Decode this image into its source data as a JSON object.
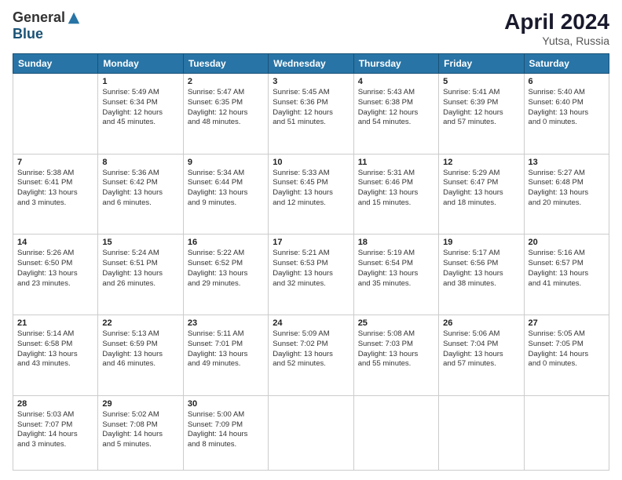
{
  "header": {
    "logo_general": "General",
    "logo_blue": "Blue",
    "month_year": "April 2024",
    "location": "Yutsa, Russia"
  },
  "weekdays": [
    "Sunday",
    "Monday",
    "Tuesday",
    "Wednesday",
    "Thursday",
    "Friday",
    "Saturday"
  ],
  "weeks": [
    [
      {
        "day": "",
        "info": ""
      },
      {
        "day": "1",
        "info": "Sunrise: 5:49 AM\nSunset: 6:34 PM\nDaylight: 12 hours\nand 45 minutes."
      },
      {
        "day": "2",
        "info": "Sunrise: 5:47 AM\nSunset: 6:35 PM\nDaylight: 12 hours\nand 48 minutes."
      },
      {
        "day": "3",
        "info": "Sunrise: 5:45 AM\nSunset: 6:36 PM\nDaylight: 12 hours\nand 51 minutes."
      },
      {
        "day": "4",
        "info": "Sunrise: 5:43 AM\nSunset: 6:38 PM\nDaylight: 12 hours\nand 54 minutes."
      },
      {
        "day": "5",
        "info": "Sunrise: 5:41 AM\nSunset: 6:39 PM\nDaylight: 12 hours\nand 57 minutes."
      },
      {
        "day": "6",
        "info": "Sunrise: 5:40 AM\nSunset: 6:40 PM\nDaylight: 13 hours\nand 0 minutes."
      }
    ],
    [
      {
        "day": "7",
        "info": "Sunrise: 5:38 AM\nSunset: 6:41 PM\nDaylight: 13 hours\nand 3 minutes."
      },
      {
        "day": "8",
        "info": "Sunrise: 5:36 AM\nSunset: 6:42 PM\nDaylight: 13 hours\nand 6 minutes."
      },
      {
        "day": "9",
        "info": "Sunrise: 5:34 AM\nSunset: 6:44 PM\nDaylight: 13 hours\nand 9 minutes."
      },
      {
        "day": "10",
        "info": "Sunrise: 5:33 AM\nSunset: 6:45 PM\nDaylight: 13 hours\nand 12 minutes."
      },
      {
        "day": "11",
        "info": "Sunrise: 5:31 AM\nSunset: 6:46 PM\nDaylight: 13 hours\nand 15 minutes."
      },
      {
        "day": "12",
        "info": "Sunrise: 5:29 AM\nSunset: 6:47 PM\nDaylight: 13 hours\nand 18 minutes."
      },
      {
        "day": "13",
        "info": "Sunrise: 5:27 AM\nSunset: 6:48 PM\nDaylight: 13 hours\nand 20 minutes."
      }
    ],
    [
      {
        "day": "14",
        "info": "Sunrise: 5:26 AM\nSunset: 6:50 PM\nDaylight: 13 hours\nand 23 minutes."
      },
      {
        "day": "15",
        "info": "Sunrise: 5:24 AM\nSunset: 6:51 PM\nDaylight: 13 hours\nand 26 minutes."
      },
      {
        "day": "16",
        "info": "Sunrise: 5:22 AM\nSunset: 6:52 PM\nDaylight: 13 hours\nand 29 minutes."
      },
      {
        "day": "17",
        "info": "Sunrise: 5:21 AM\nSunset: 6:53 PM\nDaylight: 13 hours\nand 32 minutes."
      },
      {
        "day": "18",
        "info": "Sunrise: 5:19 AM\nSunset: 6:54 PM\nDaylight: 13 hours\nand 35 minutes."
      },
      {
        "day": "19",
        "info": "Sunrise: 5:17 AM\nSunset: 6:56 PM\nDaylight: 13 hours\nand 38 minutes."
      },
      {
        "day": "20",
        "info": "Sunrise: 5:16 AM\nSunset: 6:57 PM\nDaylight: 13 hours\nand 41 minutes."
      }
    ],
    [
      {
        "day": "21",
        "info": "Sunrise: 5:14 AM\nSunset: 6:58 PM\nDaylight: 13 hours\nand 43 minutes."
      },
      {
        "day": "22",
        "info": "Sunrise: 5:13 AM\nSunset: 6:59 PM\nDaylight: 13 hours\nand 46 minutes."
      },
      {
        "day": "23",
        "info": "Sunrise: 5:11 AM\nSunset: 7:01 PM\nDaylight: 13 hours\nand 49 minutes."
      },
      {
        "day": "24",
        "info": "Sunrise: 5:09 AM\nSunset: 7:02 PM\nDaylight: 13 hours\nand 52 minutes."
      },
      {
        "day": "25",
        "info": "Sunrise: 5:08 AM\nSunset: 7:03 PM\nDaylight: 13 hours\nand 55 minutes."
      },
      {
        "day": "26",
        "info": "Sunrise: 5:06 AM\nSunset: 7:04 PM\nDaylight: 13 hours\nand 57 minutes."
      },
      {
        "day": "27",
        "info": "Sunrise: 5:05 AM\nSunset: 7:05 PM\nDaylight: 14 hours\nand 0 minutes."
      }
    ],
    [
      {
        "day": "28",
        "info": "Sunrise: 5:03 AM\nSunset: 7:07 PM\nDaylight: 14 hours\nand 3 minutes."
      },
      {
        "day": "29",
        "info": "Sunrise: 5:02 AM\nSunset: 7:08 PM\nDaylight: 14 hours\nand 5 minutes."
      },
      {
        "day": "30",
        "info": "Sunrise: 5:00 AM\nSunset: 7:09 PM\nDaylight: 14 hours\nand 8 minutes."
      },
      {
        "day": "",
        "info": ""
      },
      {
        "day": "",
        "info": ""
      },
      {
        "day": "",
        "info": ""
      },
      {
        "day": "",
        "info": ""
      }
    ]
  ]
}
